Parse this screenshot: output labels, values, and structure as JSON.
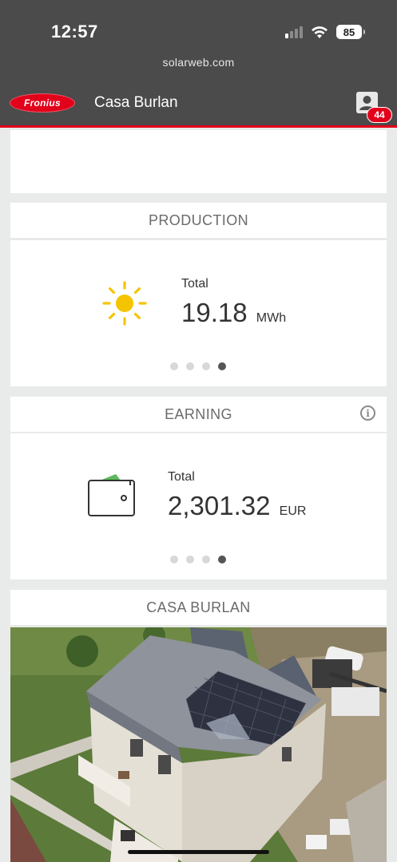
{
  "status_bar": {
    "time": "12:57",
    "battery": "85"
  },
  "browser": {
    "url": "solarweb.com"
  },
  "app": {
    "logo_text": "Fronius",
    "title": "Casa Burlan",
    "notification_count": "44",
    "accent": "#e2001a"
  },
  "production": {
    "heading": "PRODUCTION",
    "total_label": "Total",
    "total_value": "19.18",
    "total_unit": "MWh",
    "page_dots": 4,
    "active_page": 4,
    "icon": "sun-icon"
  },
  "earning": {
    "heading": "EARNING",
    "total_label": "Total",
    "total_value": "2,301.32",
    "total_unit": "EUR",
    "page_dots": 4,
    "active_page": 4,
    "icon": "wallet-icon",
    "info_icon": "info-icon"
  },
  "site": {
    "heading": "CASA BURLAN"
  }
}
